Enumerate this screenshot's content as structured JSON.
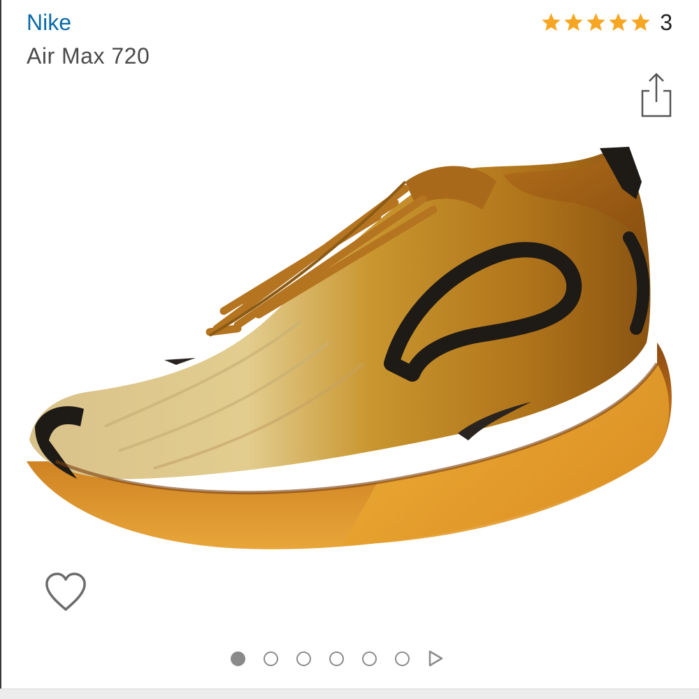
{
  "product": {
    "brand": "Nike",
    "name": "Air Max 720",
    "rating": {
      "stars": 5,
      "max_stars": 5,
      "count": "3"
    }
  },
  "icons": {
    "share": "share-icon",
    "wishlist": "heart-outline-icon",
    "star": "star-icon",
    "play": "play-icon"
  },
  "gallery": {
    "total_images": 6,
    "active_index": 0,
    "has_video": true
  },
  "colors": {
    "brand_link": "#0a6aa8",
    "star": "#f6a623",
    "dot": "#8a8a8a"
  }
}
